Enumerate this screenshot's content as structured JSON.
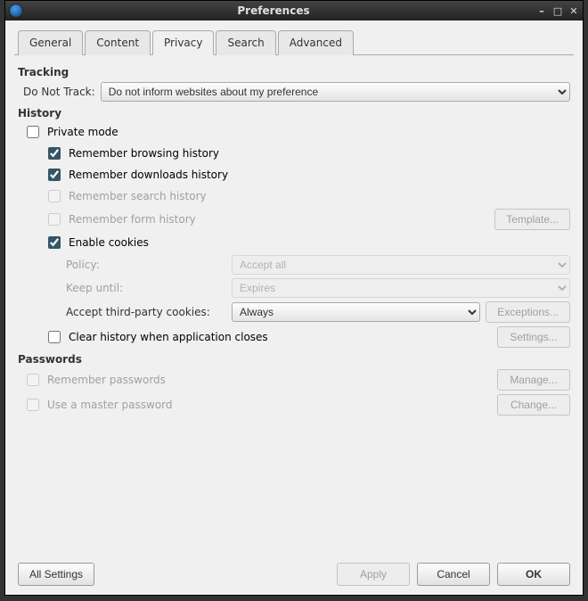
{
  "window": {
    "title": "Preferences"
  },
  "tabs": {
    "general": "General",
    "content": "Content",
    "privacy": "Privacy",
    "search": "Search",
    "advanced": "Advanced"
  },
  "tracking": {
    "heading": "Tracking",
    "do_not_track_label": "Do Not Track:",
    "do_not_track_value": "Do not inform websites about my preference"
  },
  "history": {
    "heading": "History",
    "private_mode": "Private mode",
    "remember_browsing": "Remember browsing history",
    "remember_downloads": "Remember downloads history",
    "remember_search": "Remember search history",
    "remember_form": "Remember form history",
    "template_btn": "Template...",
    "enable_cookies": "Enable cookies",
    "policy_label": "Policy:",
    "policy_value": "Accept all",
    "keep_label": "Keep until:",
    "keep_value": "Expires",
    "third_party_label": "Accept third-party cookies:",
    "third_party_value": "Always",
    "exceptions_btn": "Exceptions...",
    "clear_on_close": "Clear history when application closes",
    "settings_btn": "Settings..."
  },
  "passwords": {
    "heading": "Passwords",
    "remember": "Remember passwords",
    "manage_btn": "Manage...",
    "master": "Use a master password",
    "change_btn": "Change..."
  },
  "buttons": {
    "all_settings": "All Settings",
    "apply": "Apply",
    "cancel": "Cancel",
    "ok": "OK"
  }
}
